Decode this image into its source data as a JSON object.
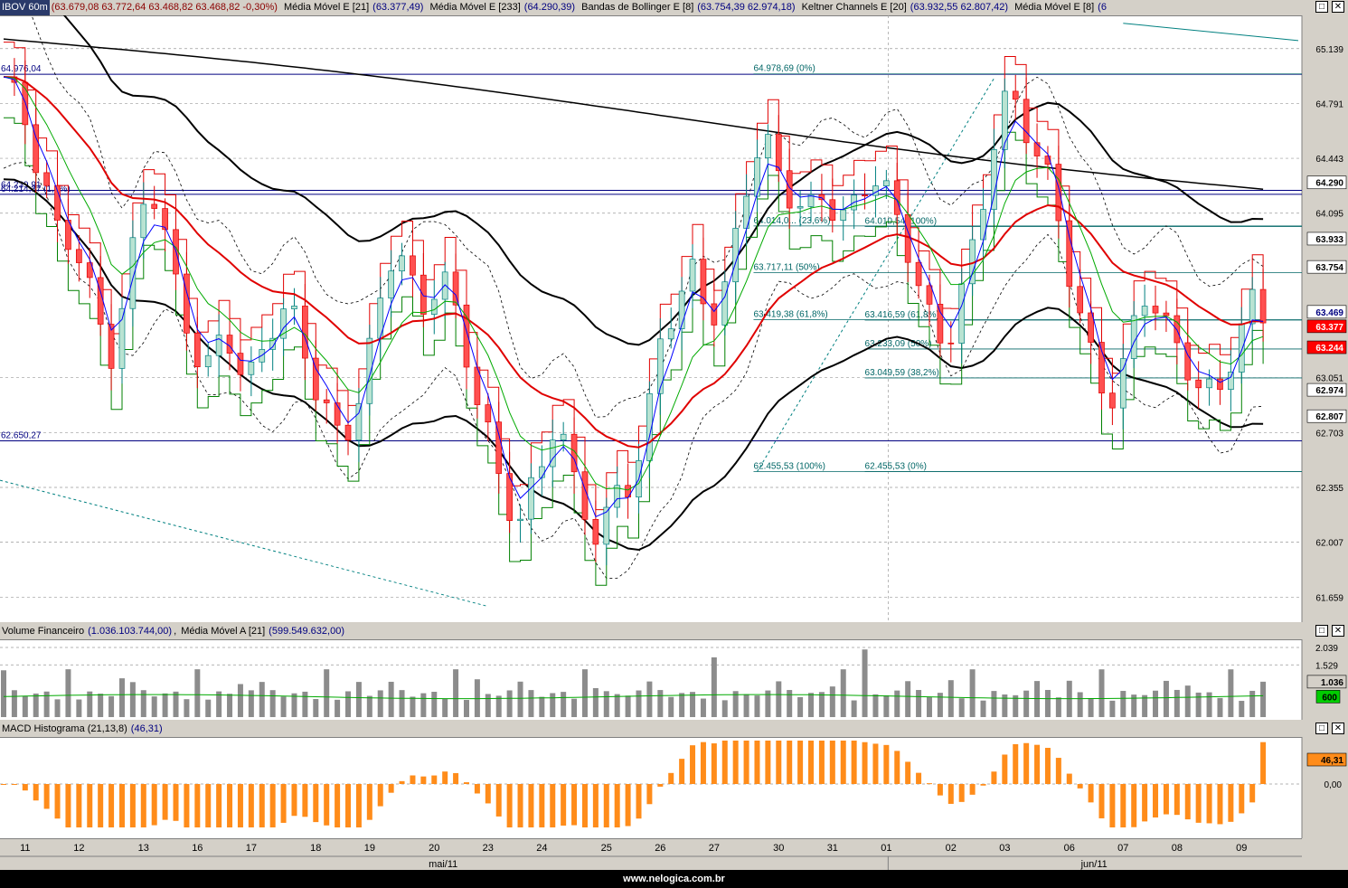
{
  "price_pane": {
    "title": "IBOV 60m",
    "ohlc": "63.679,08  63.772,64  63.468,82  63.468,82  -0,30%",
    "indicators": [
      {
        "name": "Média Móvel E [21]",
        "value": "63.377,49"
      },
      {
        "name": "Média Móvel E [233]",
        "value": "64.290,39"
      },
      {
        "name": "Bandas de Bollinger E [8]",
        "value": "63.754,39  62.974,18"
      },
      {
        "name": "Keltner Channels E [20]",
        "value": "63.932,55  62.807,42"
      },
      {
        "name": "Média Móvel E [8]",
        "value": "6"
      }
    ],
    "y_ticks": [
      "65.139",
      "64.791",
      "64.443",
      "64.095",
      "63.051",
      "62.703",
      "62.355",
      "62.007",
      "61.659"
    ],
    "y_tick_values": [
      65139,
      64791,
      64443,
      64095,
      63051,
      62703,
      62355,
      62007,
      61659
    ],
    "badges": [
      {
        "value": 64290,
        "text": "64.290",
        "bg": "#ffffff",
        "fg": "#000000"
      },
      {
        "value": 63933,
        "text": "63.933",
        "bg": "#ffffff",
        "fg": "#000000"
      },
      {
        "value": 63754,
        "text": "63.754",
        "bg": "#ffffff",
        "fg": "#000000"
      },
      {
        "value": 63469,
        "text": "63.469",
        "bg": "#ffffff",
        "fg": "#000080"
      },
      {
        "value": 63377,
        "text": "63.377",
        "bg": "#ff0000",
        "fg": "#ffffff"
      },
      {
        "value": 63244,
        "text": "63.244",
        "bg": "#ff0000",
        "fg": "#ffffff"
      },
      {
        "value": 62974,
        "text": "62.974",
        "bg": "#ffffff",
        "fg": "#000000"
      },
      {
        "value": 62807,
        "text": "62.807",
        "bg": "#ffffff",
        "fg": "#000000"
      }
    ],
    "hlines": [
      {
        "value": 64976.04,
        "label": "64.976,04"
      },
      {
        "value": 64239.91,
        "label": "64.239,91"
      },
      {
        "value": 64214.37,
        "label": "64.214,37 (1,8%)"
      },
      {
        "value": 62650.27,
        "label": "62.650,27"
      }
    ],
    "fib_set_1": [
      {
        "value": 64978.69,
        "label": "64.978,69 (0%)"
      },
      {
        "value": 64014.0,
        "label": "64.014,0... (23,6%)"
      },
      {
        "value": 63717.11,
        "label": "63.717,11 (50%)"
      },
      {
        "value": 63419.38,
        "label": "63.419,38 (61,8%)"
      },
      {
        "value": 62455.53,
        "label": "62.455,53 (100%)"
      }
    ],
    "fib_set_2": [
      {
        "value": 64010.54,
        "label": "64.010,54 (100%)"
      },
      {
        "value": 63416.59,
        "label": "63.416,59 (61,8%)"
      },
      {
        "value": 63233.09,
        "label": "63.233,09 (50%)"
      },
      {
        "value": 63049.59,
        "label": "63.049,59 (38,2%)"
      },
      {
        "value": 62455.53,
        "label": "62.455,53 (0%)"
      }
    ]
  },
  "volume_pane": {
    "title": "Volume Financeiro",
    "value": "1.036.103.744,00",
    "ma_name": "Média Móvel A [21]",
    "ma_value": "599.549.632,00",
    "y_ticks": [
      "2.039",
      "1.529"
    ],
    "badge_value": "1.036",
    "badge_ma": "600"
  },
  "macd_pane": {
    "title": "MACD Histograma (21,13,8)",
    "value": "46,31",
    "zero_label": "0,00",
    "badge": "46,31"
  },
  "x_axis": {
    "day_labels": [
      "11",
      "12",
      "13",
      "16",
      "17",
      "18",
      "19",
      "20",
      "23",
      "24",
      "25",
      "26",
      "27",
      "30",
      "31",
      "01",
      "02",
      "03",
      "06",
      "07",
      "08",
      "09"
    ],
    "months": [
      "mai/11",
      "jun/11"
    ]
  },
  "footer": "www.nelogica.com.br",
  "chart_data": {
    "type": "candlestick",
    "title": "IBOV 60m",
    "ylim": [
      61500,
      65350
    ],
    "series": [
      {
        "name": "Média Móvel E [21]",
        "color": "#e00000"
      },
      {
        "name": "Média Móvel E [233]",
        "color": "#000000"
      },
      {
        "name": "Bandas de Bollinger E [8]",
        "color": "#000000"
      },
      {
        "name": "Keltner Channels E [20]",
        "color": "#000000"
      },
      {
        "name": "Média Móvel E [8]",
        "color": "#00aa00"
      }
    ],
    "close_path": [
      64900,
      64800,
      64700,
      64500,
      64300,
      64000,
      63900,
      63800,
      63600,
      63400,
      63200,
      63500,
      63800,
      64100,
      64200,
      64000,
      63700,
      63500,
      63300,
      63100,
      63200,
      63300,
      63100,
      63000,
      63200,
      63400,
      63500,
      63450,
      63300,
      63000,
      62900,
      62800,
      62700,
      62850,
      63000,
      63300,
      63600,
      63900,
      63800,
      63600,
      63500,
      63700,
      63600,
      63300,
      63100,
      62900,
      62700,
      62400,
      62200,
      62100,
      62300,
      62500,
      62800,
      62700,
      62400,
      62200,
      62000,
      62100,
      62300,
      62400,
      62600,
      62900,
      63300,
      63400,
      63500,
      63700,
      63600,
      63500,
      63600,
      63900,
      64200,
      64400,
      64500,
      64400,
      64300,
      64200,
      64100,
      64200,
      64100,
      64000,
      64100,
      64300,
      64400,
      64300,
      64100,
      63900,
      63700,
      63500,
      63400,
      63300,
      63500,
      63700,
      63900,
      64300,
      64700,
      64900,
      64800,
      64600,
      64400,
      64200,
      63900,
      63600,
      63400,
      63200,
      63000,
      62900,
      63100,
      63400,
      63600,
      63500,
      63400,
      63300,
      63100,
      62900,
      62900,
      63000,
      63200,
      63400,
      63600,
      63470
    ],
    "candle_count": 118,
    "volume": {
      "ma": 600,
      "last": 1036,
      "max": 2039
    },
    "macd": {
      "last": 46.31
    }
  }
}
